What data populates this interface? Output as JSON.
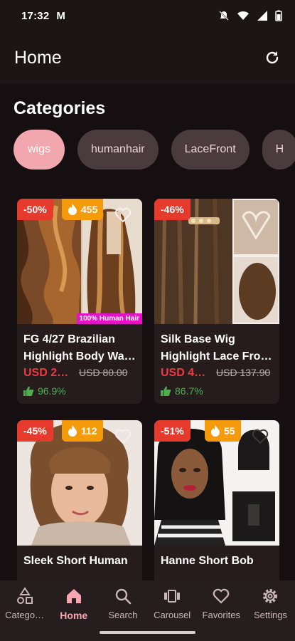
{
  "status_bar": {
    "time": "17:32",
    "mail_glyph": "M"
  },
  "app_bar": {
    "title": "Home"
  },
  "categories": {
    "title": "Categories",
    "chips": [
      "wigs",
      "humanhair",
      "LaceFront",
      "H"
    ]
  },
  "products": [
    {
      "discount": "-50%",
      "hot": "455",
      "name_line1": "FG 4/27 Brazilian",
      "name_line2": "Highlight Body Wav…",
      "price": "USD 20.…",
      "old_price": "USD 80.00",
      "rating": "96.9%",
      "image_label": "100% Human Hair"
    },
    {
      "discount": "-46%",
      "hot": "",
      "name_line1": "Silk Base Wig",
      "name_line2": "Highlight Lace Fron…",
      "price": "USD 40.…",
      "old_price": "USD 137.90",
      "rating": "86.7%"
    },
    {
      "discount": "-45%",
      "hot": "112",
      "name_line1": "Sleek Short Human",
      "name_line2": ""
    },
    {
      "discount": "-51%",
      "hot": "55",
      "name_line1": "Hanne Short Bob",
      "name_line2": ""
    }
  ],
  "nav": {
    "items": [
      "Catego…",
      "Home",
      "Search",
      "Carousel",
      "Favorites",
      "Settings"
    ],
    "active": "Home"
  },
  "colors": {
    "accent": "#f5a6b0",
    "sale": "#ec3b3f",
    "discount_badge": "#e53a2c",
    "hot_badge": "#f59a0b",
    "rating": "#4caf50"
  }
}
